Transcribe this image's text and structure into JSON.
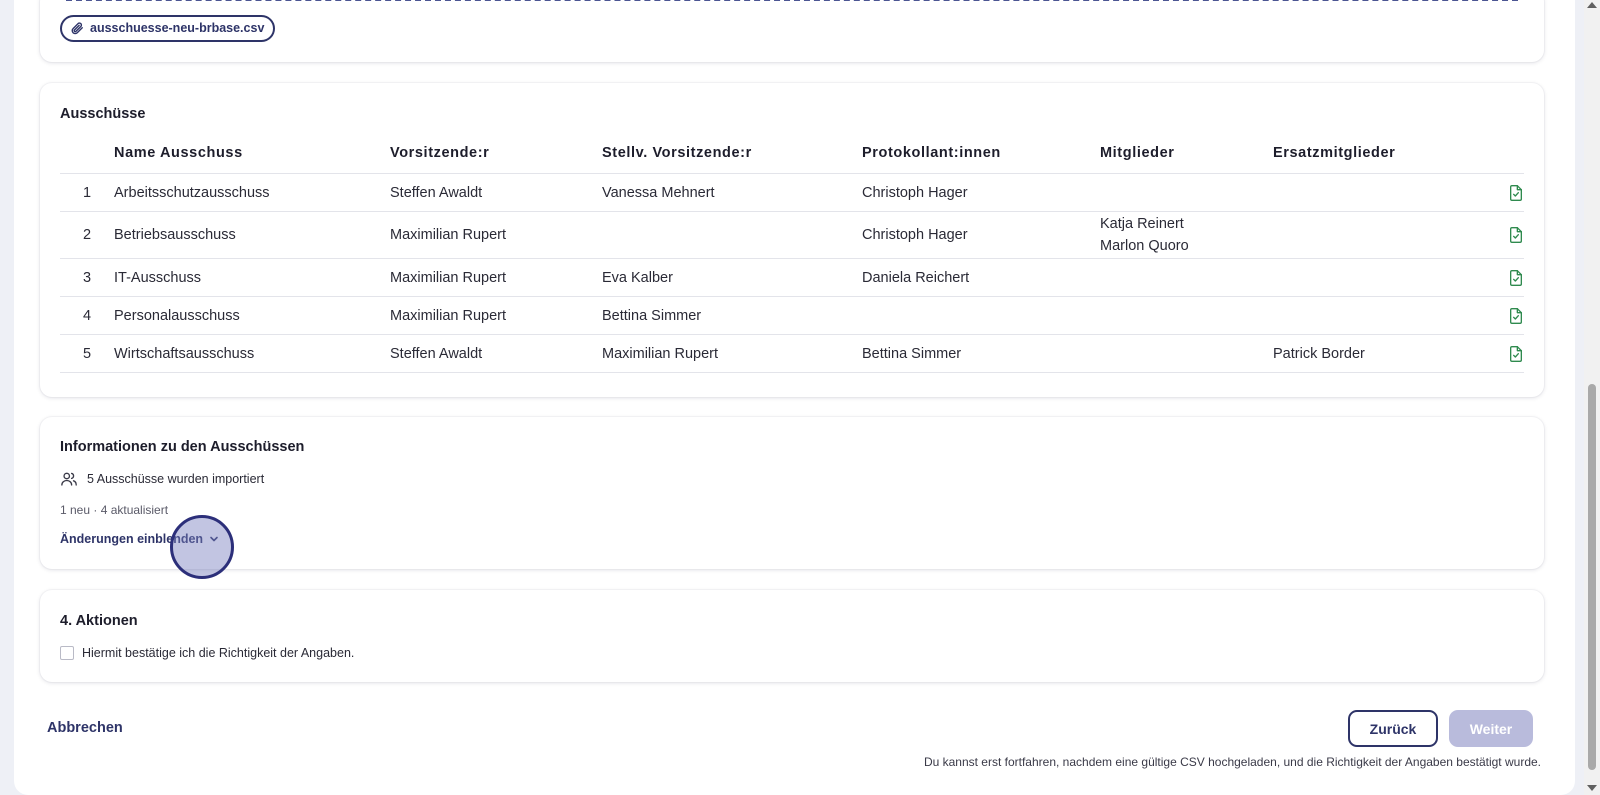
{
  "upload": {
    "file_name": "ausschuesse-neu-brbase.csv"
  },
  "committees": {
    "title": "Ausschüsse",
    "columns": [
      "",
      "Name Ausschuss",
      "Vorsitzende:r",
      "Stellv. Vorsitzende:r",
      "Protokollant:innen",
      "Mitglieder",
      "Ersatzmitglieder",
      ""
    ],
    "rows": [
      {
        "index": "1",
        "name": "Arbeitsschutzausschuss",
        "chair": "Steffen Awaldt",
        "vice_chair": "Vanessa Mehnert",
        "secretary": "Christoph Hager",
        "members": [],
        "substitutes": ""
      },
      {
        "index": "2",
        "name": "Betriebsausschuss",
        "chair": "Maximilian Rupert",
        "vice_chair": "",
        "secretary": "Christoph Hager",
        "members": [
          "Katja Reinert",
          "Marlon Quoro"
        ],
        "substitutes": ""
      },
      {
        "index": "3",
        "name": "IT-Ausschuss",
        "chair": "Maximilian Rupert",
        "vice_chair": "Eva Kalber",
        "secretary": "Daniela Reichert",
        "members": [],
        "substitutes": ""
      },
      {
        "index": "4",
        "name": "Personalausschuss",
        "chair": "Maximilian Rupert",
        "vice_chair": "Bettina Simmer",
        "secretary": "",
        "members": [],
        "substitutes": ""
      },
      {
        "index": "5",
        "name": "Wirtschaftsausschuss",
        "chair": "Steffen Awaldt",
        "vice_chair": "Maximilian Rupert",
        "secretary": "Bettina Simmer",
        "members": [],
        "substitutes": "Patrick Border"
      }
    ],
    "row_icon": "file-check-icon",
    "row_icon_color": "#2f8a4e"
  },
  "info": {
    "title": "Informationen zu den Ausschüssen",
    "imported_text": "5 Ausschüsse wurden importiert",
    "imported_icon": "users-icon",
    "summary": "1 neu · 4 aktualisiert",
    "toggle_label": "Änderungen einblenden",
    "toggle_icon": "chevron-down-icon"
  },
  "actions": {
    "title": "4. Aktionen",
    "confirm_label": "Hiermit bestätige ich die Richtigkeit der Angaben.",
    "confirm_checked": false
  },
  "footer": {
    "cancel_label": "Abbrechen",
    "back_label": "Zurück",
    "next_label": "Weiter",
    "hint": "Du kannst erst fortfahren, nachdem eine gültige CSV hochgeladen, und die Richtigkeit der Angaben bestätigt wurde."
  },
  "colors": {
    "primary": "#2e3468",
    "disabled_button": "#b9bbdc",
    "success": "#2f8a4e"
  }
}
